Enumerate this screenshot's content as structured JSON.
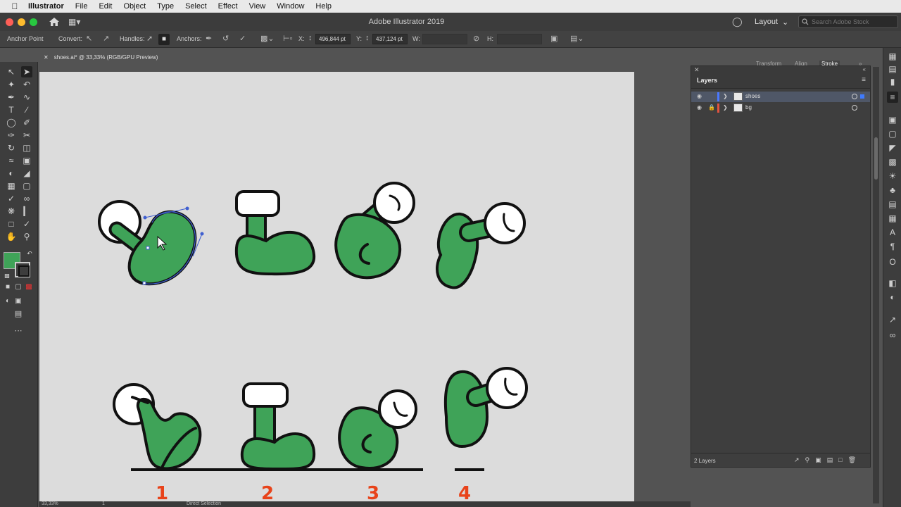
{
  "menubar": {
    "app": "Illustrator",
    "items": [
      "File",
      "Edit",
      "Object",
      "Type",
      "Select",
      "Effect",
      "View",
      "Window",
      "Help"
    ]
  },
  "titlebar": {
    "title": "Adobe Illustrator 2019",
    "workspace": "Layout",
    "search_placeholder": "Search Adobe Stock"
  },
  "controlbar": {
    "tool_name": "Anchor Point",
    "convert_label": "Convert:",
    "handles_label": "Handles:",
    "anchors_label": "Anchors:",
    "x_label": "X:",
    "x_value": "496,844 pt",
    "y_label": "Y:",
    "y_value": "437,124 pt",
    "w_label": "W:",
    "h_label": "H:"
  },
  "document": {
    "tab_label": "shoes.ai* @ 33,33% (RGB/GPU Preview)"
  },
  "artwork": {
    "labels": [
      "1",
      "2",
      "3",
      "4"
    ],
    "shoe_color": "#3fa358",
    "label_color": "#e8431a"
  },
  "panel_tabs": [
    "Transform",
    "Align",
    "Stroke"
  ],
  "layers": {
    "title": "Layers",
    "rows": [
      {
        "name": "shoes",
        "color": "#4a78ff"
      },
      {
        "name": "bg",
        "color": "#e0533f"
      }
    ],
    "count": "2 Layers"
  },
  "status": {
    "zoom": "33,33%",
    "page": "1",
    "tool": "Direct Selection"
  },
  "colors": {
    "fill": "#3fa358",
    "selection": "#3f5fd0"
  }
}
